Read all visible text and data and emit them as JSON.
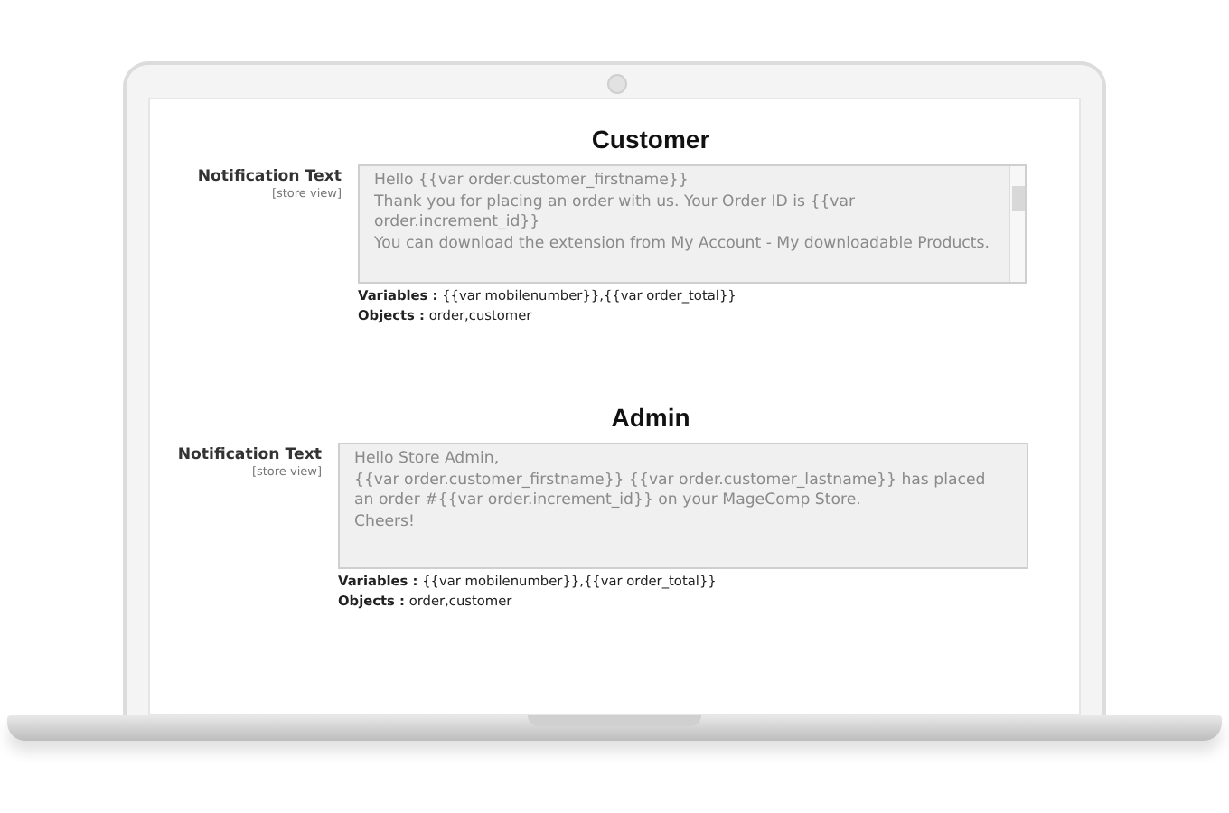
{
  "sections": [
    {
      "title": "Customer",
      "label": "Notification Text",
      "scope": "[store view]",
      "scrollbar": true,
      "lines": [
        "Hello {{var order.customer_firstname}}",
        "Thank you for placing an order with us. Your Order ID is {{var order.increment_id}}",
        "You can download the extension from My Account - My downloadable Products."
      ],
      "variables": "**Variables :** {{var mobilenumber}},{{var order_total}}",
      "objects": "**Objects :** order,customer"
    },
    {
      "title": "Admin",
      "label": "Notification Text",
      "scope": "[store view]",
      "scrollbar": false,
      "lines": [
        "Hello Store Admin,",
        "{{var order.customer_firstname}} {{var order.customer_lastname}} has placed an order #{{var order.increment_id}} on your MageComp Store.",
        "Cheers!"
      ],
      "variables": "**Variables :** {{var mobilenumber}},{{var order_total}}",
      "objects": "**Objects :** order,customer"
    }
  ]
}
